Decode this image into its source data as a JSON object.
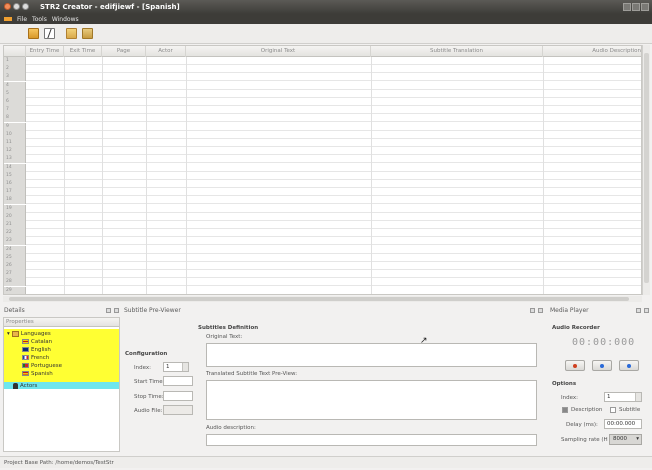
{
  "window": {
    "title": "STR2 Creator - edifjiewf - [Spanish]"
  },
  "menu": [
    "File",
    "Tools",
    "Windows"
  ],
  "grid": {
    "columns": [
      "",
      "Entry Time",
      "Exit Time",
      "Page",
      "Actor",
      "Original Text",
      "Subtitle Translation",
      "Audio Description"
    ],
    "row_numbers": [
      "1",
      "2",
      "3",
      "4",
      "5",
      "6",
      "7",
      "8",
      "9",
      "10",
      "11",
      "12",
      "13",
      "14",
      "15",
      "16",
      "17",
      "18",
      "19",
      "20",
      "21",
      "22",
      "23",
      "24",
      "25",
      "26",
      "27",
      "28",
      "29"
    ]
  },
  "panels": {
    "details_title": "Details",
    "preview_title": "Subtitle Pre-Viewer",
    "media_title": "Media Player"
  },
  "details": {
    "properties_header": "Properties",
    "languages": "Languages",
    "items": [
      "Catalan",
      "English",
      "French",
      "Portuguese",
      "Spanish"
    ],
    "actors": "Actors"
  },
  "preview": {
    "configuration": "Configuration",
    "index_label": "Index:",
    "index_value": "1",
    "start_time": "Start Time:",
    "stop_time": "Stop Time:",
    "audio_file": "Audio File:",
    "definition": "Subtitles Definition",
    "original_text": "Original Text:",
    "translated_preview": "Translated Subtitle Text Pre-View:",
    "audio_description": "Audio description:"
  },
  "media": {
    "recorder_title": "Audio Recorder",
    "timer": "00:00:000",
    "options_title": "Options",
    "index_label": "Index:",
    "index_value": "1",
    "description": "Description",
    "subtitle": "Subtitle",
    "delay_label": "Delay (ms):",
    "delay_value": "00:00.000",
    "sampling_label": "Sampling rate (H",
    "sampling_value": "8000"
  },
  "status": "Project Base Path: /home/demos/TestStr",
  "colors": {
    "details_highlight": "#ffff33",
    "actors_highlight": "#6ee6ee",
    "record": "#d04020",
    "play": "#2a6ad8"
  }
}
